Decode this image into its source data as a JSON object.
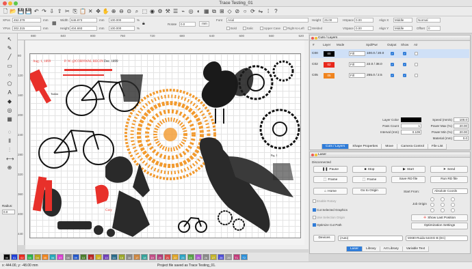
{
  "window": {
    "title": "Trace Testing_01"
  },
  "toolbar_icons": [
    "new-file-icon",
    "open-folder-icon",
    "save-icon",
    "save-as-icon",
    "undo-icon",
    "redo-icon",
    "import-icon",
    "export-icon",
    "cut-icon",
    "copy-icon",
    "paste-icon",
    "delete-icon",
    "move-icon",
    "pan-icon",
    "zoom-in-icon",
    "zoom-out-icon",
    "zoom-fit-icon",
    "zoom-page-icon",
    "frame-icon",
    "camera-icon",
    "settings-icon",
    "tools-icon",
    "align-icon",
    "trace-icon",
    "offset-icon",
    "boolean-icon",
    "grid-icon",
    "arrange-icon",
    "weld-icon",
    "node-icon",
    "break-icon",
    "close-path-icon",
    "rotate-icon",
    "mirror-icon",
    "array-icon",
    "help-icon"
  ],
  "props": {
    "xpos_label": "XPos",
    "xpos": "452.379",
    "unit_mm": "mm",
    "ypos_label": "YPos",
    "ypos": "302.315",
    "width_label": "Width",
    "width": "646.873",
    "height_label": "Height",
    "height": "404.693",
    "scale_w": "100.000",
    "scale_h": "100.000",
    "pct": "%",
    "rotate_label": "Rotate",
    "rotate": "0.0",
    "mm_btn": "mm",
    "font_label": "Font",
    "font": "Arial",
    "height2_label": "Height",
    "font_height": "25.00",
    "hspace_label": "HSpace",
    "hspace": "0.00",
    "vspace_label": "VSpace",
    "vspace": "0.00",
    "alignx_label": "Align X",
    "alignx": "Middle",
    "aligny_label": "Align Y",
    "aligny": "Middle",
    "style": "Normal",
    "offset_label": "Offset",
    "offset": "0",
    "checks": [
      "Bold",
      "Italic",
      "Upper Case",
      "Right-to-Left",
      "Welded"
    ]
  },
  "left_tools": [
    "select-icon",
    "pencil-icon",
    "line-icon",
    "rectangle-icon",
    "ellipse-icon",
    "polygon-icon",
    "text-icon",
    "node-edit-icon",
    "offset-tool-icon",
    "grid-array-icon",
    "circular-array-icon",
    "align-tool-icon",
    "distribute-icon",
    "measure-icon",
    "position-laser-icon"
  ],
  "radius": {
    "label": "Radius:",
    "value": "0.0"
  },
  "ruler_top": [
    "880",
    "840",
    "800",
    "760",
    "720",
    "680",
    "640",
    "600",
    "560",
    "520"
  ],
  "ruler_left": [
    "80",
    "120",
    "160",
    "200",
    "240",
    "280",
    "320",
    "360",
    "400",
    "440"
  ],
  "art_labels": {
    "date": "Aug. 1, 1899",
    "header": "P. W. @CORNWAL REGIN",
    "dec": "Dec. 1899",
    "tonkin": "Tonkin",
    "fig": "Fig. 1",
    "grey": "Grey"
  },
  "colors": {
    "accent": "#2f7cd8",
    "layer00": "#000000",
    "layer02": "#e8281c",
    "layer05": "#f0841e",
    "artwork_orange": "#f29a2e",
    "artwork_red": "#e8302a"
  },
  "palette": [
    {
      "label": "00",
      "color": "#000000"
    },
    {
      "label": "01",
      "color": "#1e3fd6"
    },
    {
      "label": "02",
      "color": "#e8281c"
    },
    {
      "label": "03",
      "color": "#2bb24a"
    },
    {
      "label": "04",
      "color": "#b8a21a"
    },
    {
      "label": "05",
      "color": "#f0841e"
    },
    {
      "label": "06",
      "color": "#26a7b9"
    },
    {
      "label": "07",
      "color": "#d83ccf"
    },
    {
      "label": "08",
      "color": "#8a8a8a"
    },
    {
      "label": "09",
      "color": "#2457c9"
    },
    {
      "label": "10",
      "color": "#4b7d2c"
    },
    {
      "label": "11",
      "color": "#b92323"
    },
    {
      "label": "12",
      "color": "#c9b01e"
    },
    {
      "label": "13",
      "color": "#6e3fb8"
    },
    {
      "label": "14",
      "color": "#2a6a89"
    },
    {
      "label": "15",
      "color": "#9aa628"
    },
    {
      "label": "16",
      "color": "#888888"
    },
    {
      "label": "17",
      "color": "#cd853f"
    },
    {
      "label": "18",
      "color": "#35a29a"
    },
    {
      "label": "19",
      "color": "#c04d86"
    },
    {
      "label": "20",
      "color": "#b13c7a"
    },
    {
      "label": "21",
      "color": "#d34b4b"
    },
    {
      "label": "22",
      "color": "#e0a425"
    },
    {
      "label": "23",
      "color": "#2ca3c2"
    },
    {
      "label": "24",
      "color": "#55a145"
    },
    {
      "label": "25",
      "color": "#aa55cc"
    },
    {
      "label": "26",
      "color": "#888888"
    },
    {
      "label": "27",
      "color": "#c3b32a"
    },
    {
      "label": "28",
      "color": "#4e4ed6"
    },
    {
      "label": "29",
      "color": "#9c9c9c"
    },
    {
      "label": "T1",
      "color": "#c23b7a"
    },
    {
      "label": "T2",
      "color": "#2c8fd8"
    }
  ],
  "status": {
    "coords": "x: 444.00, y: -48.00 mm",
    "message": "Project file saved as Trace Testing_01."
  },
  "cuts": {
    "title": "Cuts / Layers",
    "headers": [
      "#",
      "Layer",
      "Mode",
      "Spd/Pwr",
      "Output",
      "Show",
      "Air"
    ],
    "rows": [
      {
        "num": "C00",
        "layer": "00",
        "mode": "Fill",
        "spd": "100.0 / 20.0"
      },
      {
        "num": "C02",
        "layer": "02",
        "mode": "Fill",
        "spd": "22.0 / 38.0"
      },
      {
        "num": "C05",
        "layer": "05",
        "mode": "Fill",
        "spd": "255.0 / 2.5"
      }
    ],
    "layer_color_label": "Layer Color",
    "pass_count_label": "Pass Count",
    "pass_count": "1",
    "interval_label": "Interval (mm)",
    "interval": "0.109",
    "speed_label": "Speed (mm/s)",
    "speed": "100.0",
    "pmax_label": "Power Max (%)",
    "pmax": "20.00",
    "pmin_label": "Power Min (%)",
    "pmin": "20.00",
    "material_label": "Material (mm)",
    "material": "0.0",
    "tabs": [
      "Cuts / Layers",
      "Shape Properties",
      "Move",
      "Camera Control",
      "File List"
    ]
  },
  "laser": {
    "title": "Laser",
    "status": "Disconnected",
    "pause": "Pause",
    "stop": "Stop",
    "start": "Start",
    "send": "Send",
    "frame1": "Frame",
    "frame2": "Frame",
    "save_rd": "Save RD file",
    "run_rd": "Run RD file",
    "home": "Home",
    "go_origin": "Go to Origin",
    "start_from_label": "Start From:",
    "start_from": "Absolute Coords",
    "enable_rotary": "Enable Rotary",
    "cut_selected": "Cut Selected Graphics",
    "use_selection_origin": "Use Selection Origin",
    "optimize": "Optimize Cut Path",
    "job_origin_label": "Job Origin",
    "show_last_position": "Show Last Position",
    "opt_settings": "Optimization Settings",
    "devices": "Devices",
    "devices_sel": "(Auto)",
    "device_name": "MX80-Ruida 644XG-B (EC)",
    "tabs": [
      "Laser",
      "Library",
      "Art Library",
      "Variable Text"
    ]
  }
}
